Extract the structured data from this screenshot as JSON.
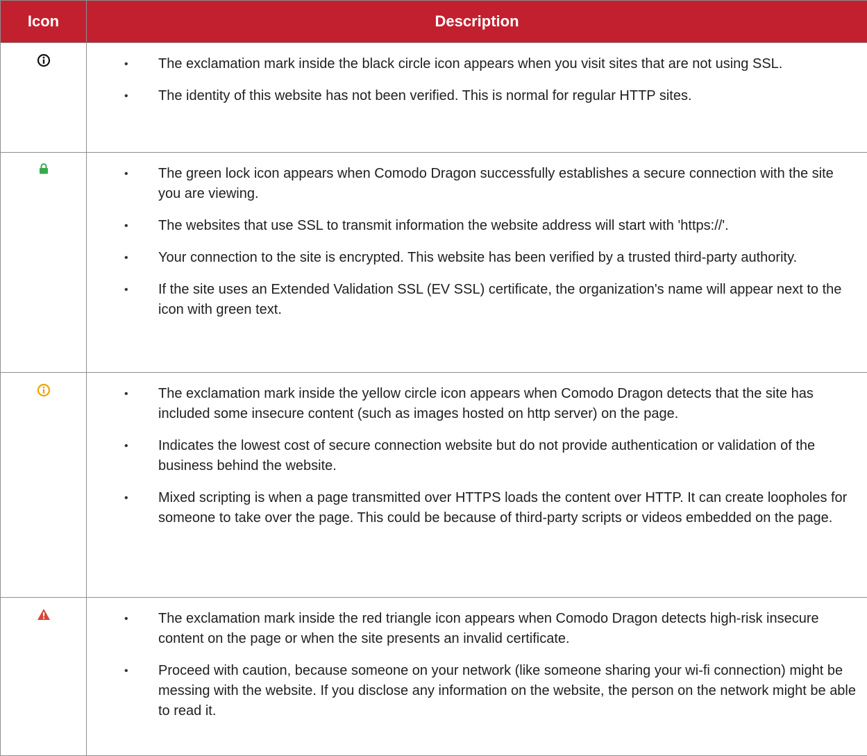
{
  "header": {
    "icon_col": "Icon",
    "description_col": "Description"
  },
  "rows": [
    {
      "icon": "black-info-circle-icon",
      "icon_color": "#111111",
      "bullets": [
        "The exclamation mark inside the black circle icon appears when you visit sites that are not using SSL.",
        "The identity of this website has not been verified. This is normal for regular HTTP sites."
      ]
    },
    {
      "icon": "green-lock-icon",
      "icon_color": "#3aa84a",
      "bullets": [
        "The green lock icon appears when Comodo Dragon successfully establishes a secure connection with the site you are viewing.",
        "The websites that use SSL to transmit information the website address will start with 'https://'.",
        "Your connection to the site is encrypted. This website has been verified by a trusted third-party authority.",
        "If the site uses an Extended Validation SSL (EV SSL) certificate, the organization's name will appear next to the icon with green text."
      ]
    },
    {
      "icon": "yellow-info-circle-icon",
      "icon_color": "#f0a400",
      "bullets": [
        "The exclamation mark inside the yellow circle icon appears when Comodo Dragon detects that the site has included some insecure content (such as images hosted on http server) on the page.",
        "Indicates the lowest cost of secure connection website but do not provide authentication or validation of the business behind the website.",
        "Mixed scripting is when a page transmitted over HTTPS loads the content over HTTP. It can create loopholes for someone to take over the page. This could be because of third-party scripts or videos embedded on the page."
      ]
    },
    {
      "icon": "red-warning-triangle-icon",
      "icon_color": "#d9463a",
      "bullets": [
        "The exclamation mark inside the red triangle icon appears when Comodo Dragon detects high-risk insecure content on the page or when the site presents an invalid certificate.",
        "Proceed with caution, because someone on your network (like someone sharing your wi-fi connection) might be messing with the website. If you disclose any information on the website, the person on the network might be able to read it."
      ]
    }
  ],
  "colors": {
    "header_bg": "#c3202f",
    "header_text": "#ffffff",
    "border": "#8e8e8e"
  }
}
